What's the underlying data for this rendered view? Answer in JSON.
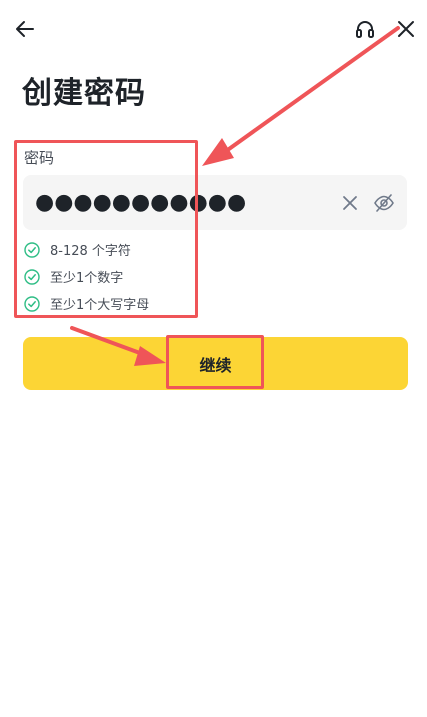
{
  "header": {
    "back_icon": "arrow-left-icon",
    "support_icon": "headset-icon",
    "close_icon": "close-icon"
  },
  "page": {
    "title": "创建密码"
  },
  "password_field": {
    "label": "密码",
    "masked_value": "●●●●●●●●●●●",
    "clear_icon": "clear-x-icon",
    "toggle_icon": "eye-off-icon"
  },
  "rules": [
    {
      "text": "8-128 个字符",
      "met": true
    },
    {
      "text": "至少1个数字",
      "met": true
    },
    {
      "text": "至少1个大写字母",
      "met": true
    }
  ],
  "continue_button": {
    "label": "继续"
  },
  "colors": {
    "accent_yellow": "#fcd535",
    "check_green": "#2ebd85",
    "annotation_red": "#ef5558",
    "input_bg": "#f5f5f5",
    "text_primary": "#1e2329",
    "text_secondary": "#474d57"
  }
}
